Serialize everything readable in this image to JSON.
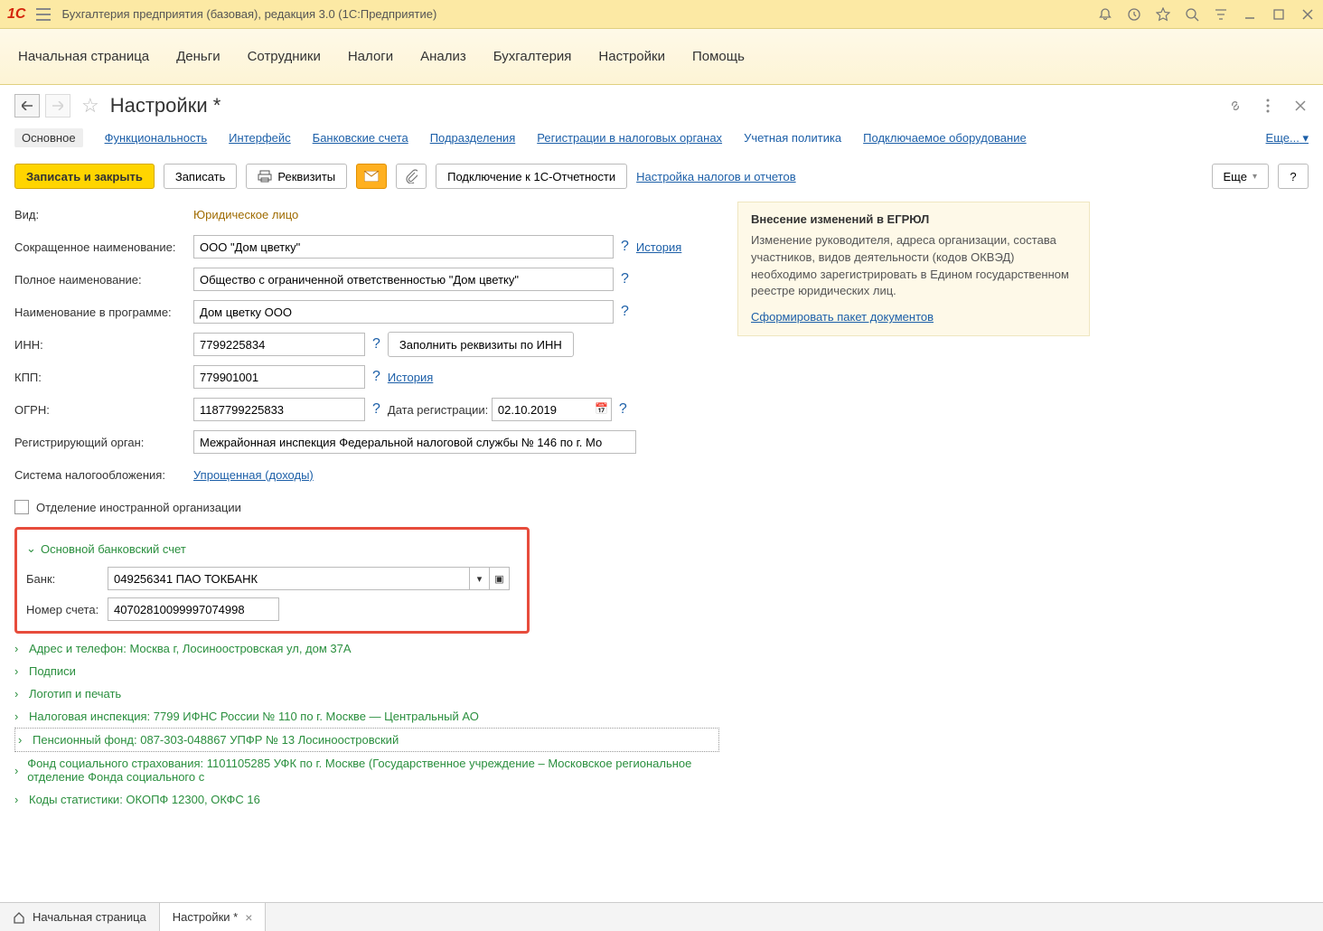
{
  "titlebar": {
    "app_title": "Бухгалтерия предприятия (базовая), редакция 3.0  (1С:Предприятие)"
  },
  "mainmenu": [
    "Начальная страница",
    "Деньги",
    "Сотрудники",
    "Налоги",
    "Анализ",
    "Бухгалтерия",
    "Настройки",
    "Помощь"
  ],
  "page": {
    "title": "Настройки *",
    "subnav": [
      "Основное",
      "Функциональность",
      "Интерфейс",
      "Банковские счета",
      "Подразделения",
      "Регистрации в налоговых органах",
      "Учетная политика",
      "Подключаемое оборудование"
    ],
    "subnav_more": "Еще..."
  },
  "toolbar": {
    "save_close": "Записать и закрыть",
    "save": "Записать",
    "rekvizity": "Реквизиты",
    "connect": "Подключение к 1С-Отчетности",
    "tax_setup": "Настройка налогов и отчетов",
    "more": "Еще"
  },
  "form": {
    "vid_label": "Вид:",
    "vid_value": "Юридическое лицо",
    "short_name_label": "Сокращенное наименование:",
    "short_name_value": "ООО \"Дом цветку\"",
    "history_link": "История",
    "full_name_label": "Полное наименование:",
    "full_name_value": "Общество с ограниченной ответственностью \"Дом цветку\"",
    "prog_name_label": "Наименование в программе:",
    "prog_name_value": "Дом цветку ООО",
    "inn_label": "ИНН:",
    "inn_value": "7799225834",
    "fill_by_inn": "Заполнить реквизиты по ИНН",
    "kpp_label": "КПП:",
    "kpp_value": "779901001",
    "ogrn_label": "ОГРН:",
    "ogrn_value": "1187799225833",
    "reg_date_label": "Дата регистрации:",
    "reg_date_value": "02.10.2019",
    "reg_org_label": "Регистрирующий орган:",
    "reg_org_value": "Межрайонная инспекция Федеральной налоговой службы № 146 по г. Мо",
    "tax_sys_label": "Система налогообложения:",
    "tax_sys_value": "Упрощенная (доходы)",
    "foreign_label": "Отделение иностранной организации",
    "bank_header": "Основной банковский счет",
    "bank_label": "Банк:",
    "bank_value": "049256341 ПАО ТОКБАНК",
    "account_label": "Номер счета:",
    "account_value": "40702810099997074998",
    "sections": [
      "Адрес и телефон: Москва г, Лосиноостровская ул, дом 37А",
      "Подписи",
      "Логотип и печать",
      "Налоговая инспекция: 7799 ИФНС России № 110 по г. Москве — Центральный АО",
      "Пенсионный фонд: 087-303-048867 УПФР № 13 Лосиноостровский",
      "Фонд социального страхования: 1101105285 УФК по г. Москве (Государственное учреждение – Московское региональное отделение Фонда социального с",
      "Коды статистики: ОКОПФ 12300, ОКФС 16"
    ]
  },
  "infobox": {
    "title": "Внесение изменений в ЕГРЮЛ",
    "text": "Изменение руководителя, адреса организации, состава участников, видов деятельности (кодов ОКВЭД) необходимо зарегистрировать в Едином государственном реестре юридических лиц.",
    "link": "Сформировать пакет документов"
  },
  "tabs": {
    "home": "Начальная страница",
    "settings": "Настройки *"
  }
}
